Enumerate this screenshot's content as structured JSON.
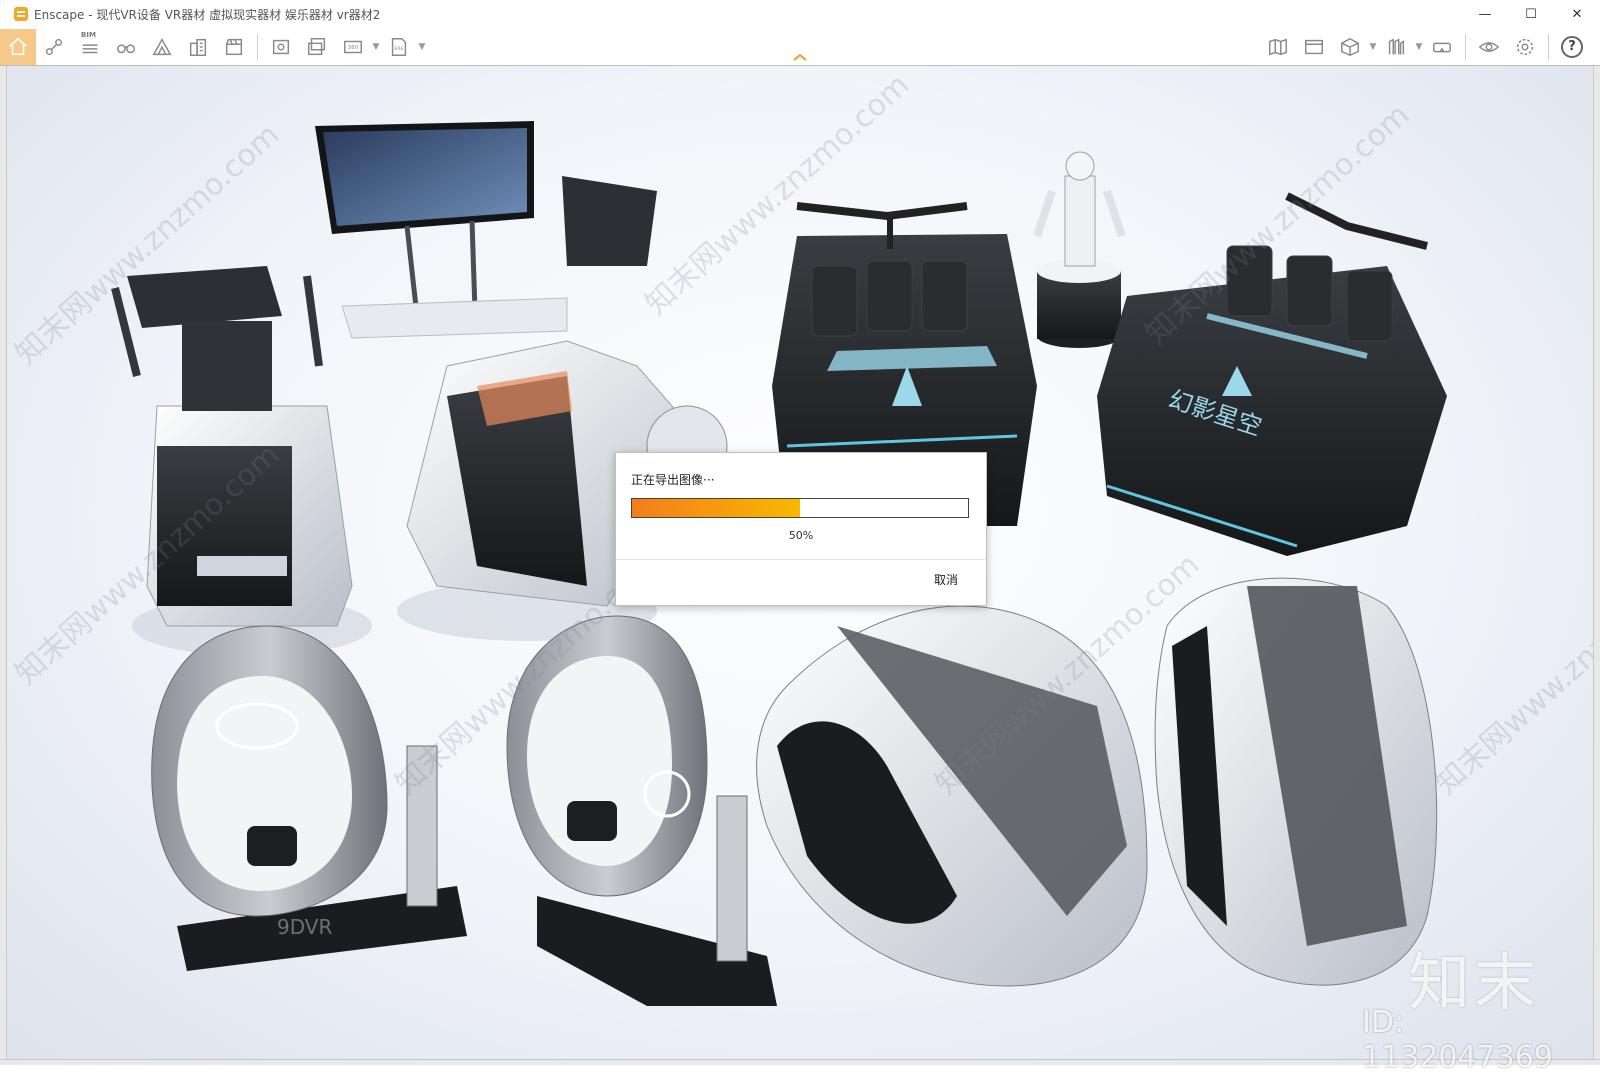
{
  "window": {
    "title": "Enscape - 现代VR设备 VR器材 虚拟现实器材 娱乐器材 vr器材2",
    "controls": {
      "minimize": "—",
      "maximize": "☐",
      "close": "✕"
    }
  },
  "toolbar": {
    "left_icons": [
      "home-icon",
      "link-icon",
      "bim-icon",
      "binoculars-icon",
      "terrain-icon",
      "buildings-icon",
      "clapper-icon",
      "screenshot-icon",
      "batch-render-icon",
      "panorama-icon",
      "export-exe-icon"
    ],
    "bim_label": "BIM",
    "right_icons": [
      "map-icon",
      "view-management-icon",
      "asset-box-icon",
      "asset-library-icon",
      "vr-headset-icon",
      "visual-settings-icon",
      "settings-gear-icon",
      "help-icon"
    ],
    "help_label": "?",
    "active_tool": "home"
  },
  "dialog": {
    "title": "正在导出图像···",
    "progress": 0.5,
    "progress_label": "50%",
    "cancel_label": "取消",
    "fill_colors": [
      "#f37e1d",
      "#f9b800"
    ]
  },
  "scene": {
    "seat_text": "幻影星空",
    "base_brand": "9DVR"
  },
  "watermark": {
    "logo": "知末",
    "id": "ID: 1132047369",
    "diagonal": "知末网www.znzmo.com"
  }
}
